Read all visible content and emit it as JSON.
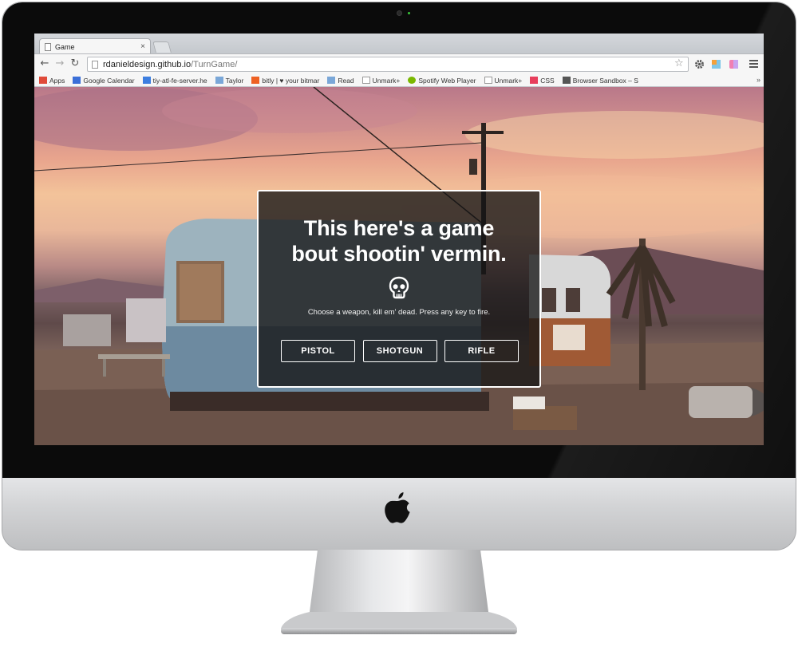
{
  "browser": {
    "tab": {
      "title": "Game",
      "close": "×"
    },
    "url": {
      "host": "rdanieldesign.github.io",
      "path": "/TurnGame/"
    },
    "nav": {
      "back": "←",
      "forward": "→",
      "reload": "↻"
    },
    "star": "☆",
    "bookmarks": [
      {
        "label": "Apps",
        "icon": "apps-grid-icon",
        "color": "#e04b3a"
      },
      {
        "label": "Google Calendar",
        "icon": "calendar-icon",
        "color": "#3b6fd8"
      },
      {
        "label": "tiy-atl-fe-server.he",
        "icon": "diamond-icon",
        "color": "#3d7ee0"
      },
      {
        "label": "Taylor",
        "icon": "folder-icon",
        "color": "#7aa7d8"
      },
      {
        "label": "bitly | ♥ your bitmar",
        "icon": "bitly-icon",
        "color": "#ee6123"
      },
      {
        "label": "Read",
        "icon": "folder-icon",
        "color": "#7aa7d8"
      },
      {
        "label": "Unmark+",
        "icon": "page-icon",
        "color": "#ffffff"
      },
      {
        "label": "Spotify Web Player",
        "icon": "spotify-icon",
        "color": "#7ab800"
      },
      {
        "label": "Unmark+",
        "icon": "page-icon",
        "color": "#ffffff"
      },
      {
        "label": "CSS",
        "icon": "css-icon",
        "color": "#e83e5c"
      },
      {
        "label": "Browser Sandbox – S",
        "icon": "briefcase-icon",
        "color": "#555555"
      }
    ],
    "more": "»"
  },
  "game": {
    "title_line1": "This here's a game",
    "title_line2": "bout shootin' vermin.",
    "icon": "skull-icon",
    "subtitle": "Choose a weapon, kill em' dead. Press any key to fire.",
    "weapons": [
      "PISTOL",
      "SHOTGUN",
      "RIFLE"
    ]
  }
}
